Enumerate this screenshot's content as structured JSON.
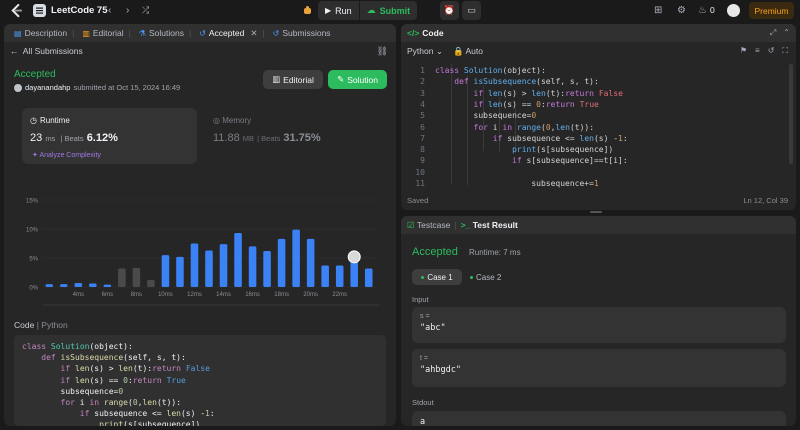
{
  "topbar": {
    "title": "LeetCode 75",
    "run_label": "Run",
    "submit_label": "Submit",
    "premium_label": "Premium",
    "streak_count": "0"
  },
  "left": {
    "tabs": [
      {
        "label": "Description",
        "icon": "description-icon"
      },
      {
        "label": "Editorial",
        "icon": "book-icon"
      },
      {
        "label": "Solutions",
        "icon": "flask-icon"
      },
      {
        "label": "Accepted",
        "icon": "history-icon"
      },
      {
        "label": "Submissions",
        "icon": "history-icon"
      }
    ],
    "all_submissions": "All Submissions",
    "status": "Accepted",
    "username": "dayanandahp",
    "submitted_text": "submitted at Oct 15, 2024 16:49",
    "editorial_btn": "Editorial",
    "solution_btn": "Solution",
    "runtime": {
      "label": "Runtime",
      "value": "23",
      "unit": "ms",
      "beats_label": "Beats",
      "beats": "6.12%",
      "analyze": "Analyze Complexity"
    },
    "memory": {
      "label": "Memory",
      "value": "11.88",
      "unit": "MB",
      "beats_label": "Beats",
      "beats": "31.75%"
    },
    "code_label": "Code",
    "code_lang": "Python",
    "code_lines": [
      "class Solution(object):",
      "    def isSubsequence(self, s, t):",
      "        if len(s) > len(t):return False",
      "        if len(s) == 0:return True",
      "        subsequence=0",
      "        for i in range(0,len(t)):",
      "            if subsequence <= len(s) -1:",
      "                print(s[subsequence])"
    ]
  },
  "chart_data": {
    "type": "bar",
    "title": "",
    "xlabel": "",
    "ylabel": "",
    "ylim": [
      0,
      15
    ],
    "yticks": [
      "15%",
      "10%",
      "5%",
      "0%"
    ],
    "xticks": [
      "4ms",
      "6ms",
      "8ms",
      "10ms",
      "12ms",
      "14ms",
      "16ms",
      "18ms",
      "20ms",
      "22ms"
    ],
    "x": [
      2,
      3,
      4,
      5,
      6,
      7,
      8,
      9,
      10,
      11,
      12,
      13,
      14,
      15,
      16,
      17,
      18,
      19,
      20,
      21,
      22,
      23,
      24
    ],
    "values": [
      0.5,
      0.5,
      0.7,
      0.6,
      0.4,
      3.2,
      3.3,
      1.2,
      5.5,
      5.2,
      7.5,
      6.3,
      7.4,
      9.3,
      7.0,
      6.2,
      8.3,
      9.9,
      8.3,
      3.7,
      3.7,
      5.9,
      3.2
    ],
    "highlight_x": 23,
    "bar_color": "#3b82f6",
    "inactive_color": "#4a4a4a",
    "grid": true
  },
  "editor": {
    "tab_label": "Code",
    "language": "Python",
    "auto_label": "Auto",
    "line_numbers": [
      "1",
      "2",
      "3",
      "4",
      "5",
      "6",
      "7",
      "8",
      "9",
      "10",
      "11"
    ],
    "saved": "Saved",
    "cursor_pos": "Ln 12, Col 39"
  },
  "tests": {
    "tab_testcase": "Testcase",
    "tab_result": "Test Result",
    "status": "Accepted",
    "runtime": "Runtime: 7 ms",
    "case1": "Case 1",
    "case2": "Case 2",
    "input_label": "Input",
    "s_name": "s =",
    "s_value": "\"abc\"",
    "t_name": "t =",
    "t_value": "\"ahbgdc\"",
    "stdout_label": "Stdout",
    "stdout_value": "a"
  }
}
